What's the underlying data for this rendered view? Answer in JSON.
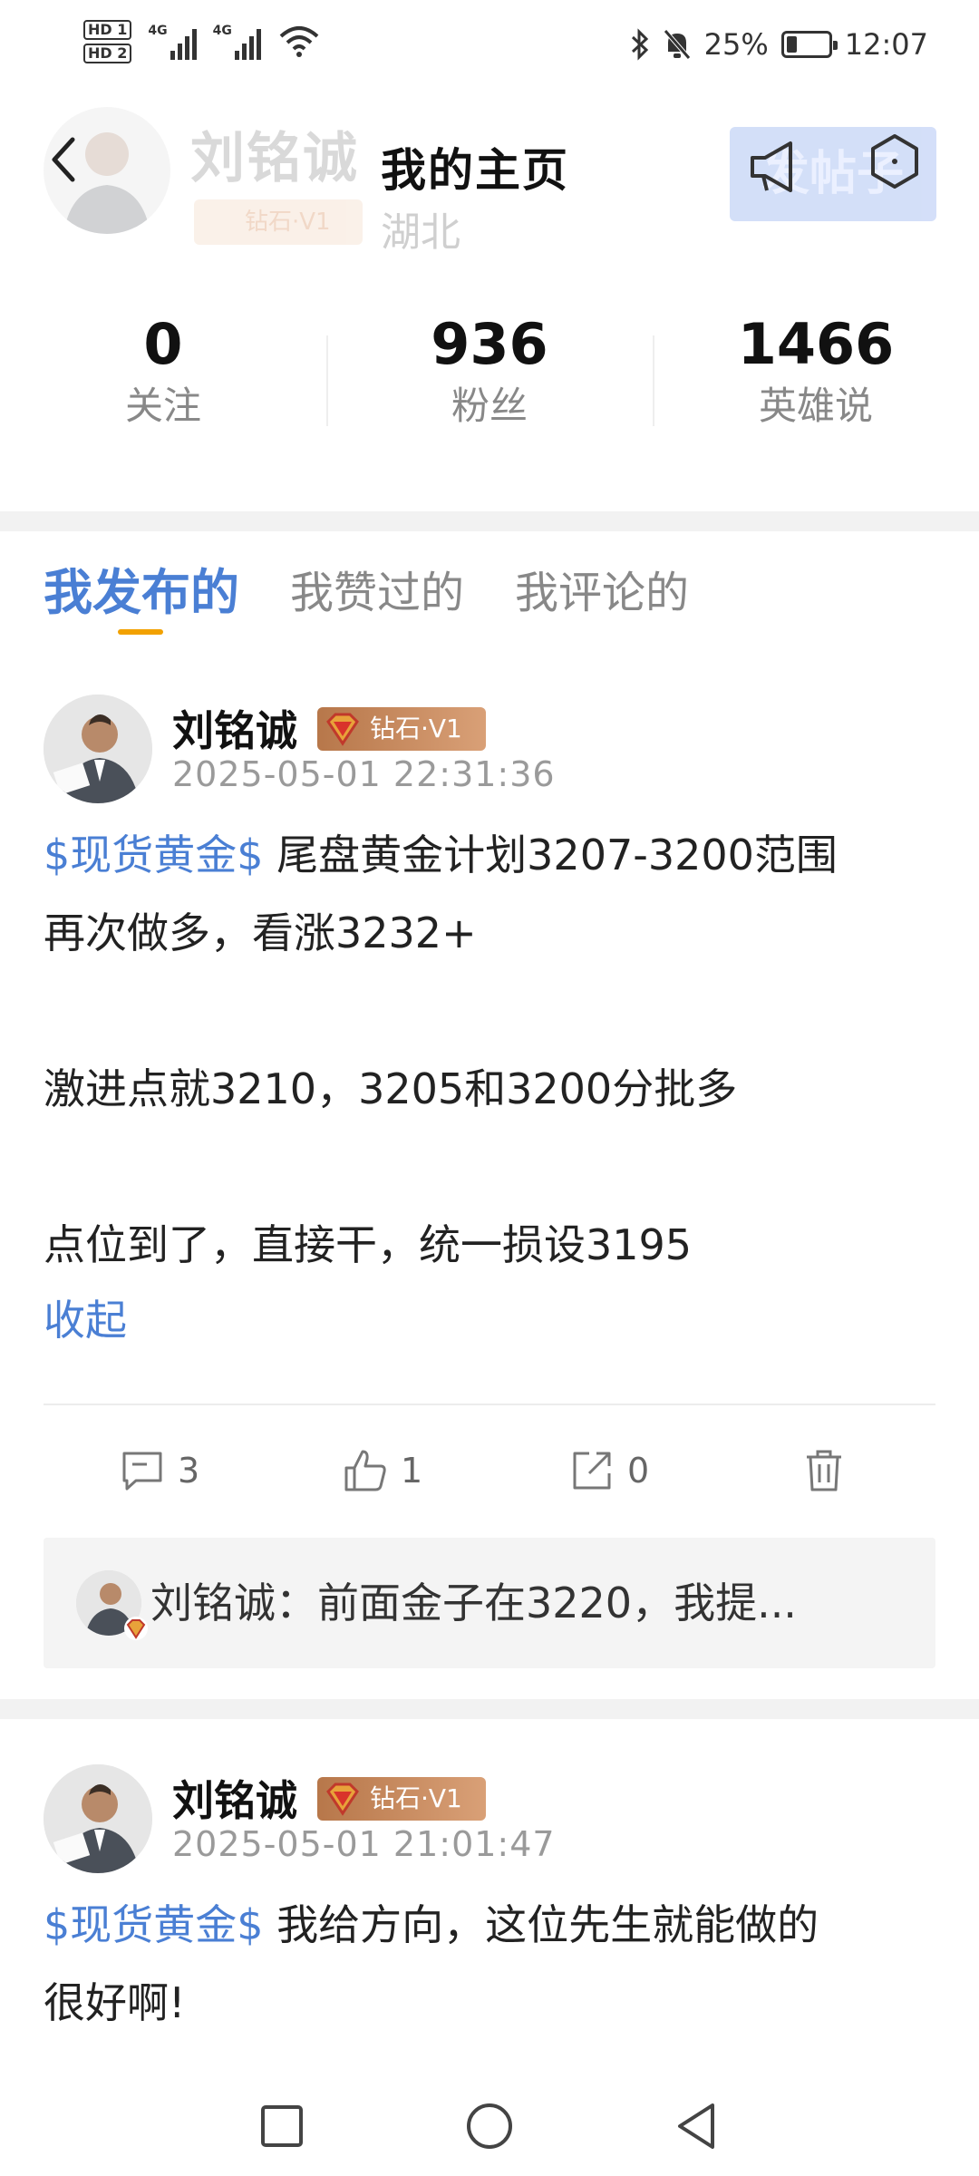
{
  "status_bar": {
    "hd1": "HD 1",
    "hd2": "HD 2",
    "net1": "4G",
    "net2": "4G",
    "battery_text": "25%",
    "battery_level": 0.25,
    "time": "12:07"
  },
  "header": {
    "faded_name": "刘铭诚",
    "faded_badge": "钻石·V1",
    "faded_region": "湖北",
    "title": "我的主页",
    "post_button_label": "发帖子"
  },
  "stats": [
    {
      "value": "0",
      "label": "关注"
    },
    {
      "value": "936",
      "label": "粉丝"
    },
    {
      "value": "1466",
      "label": "英雄说"
    }
  ],
  "tabs": [
    {
      "label": "我发布的",
      "active": true
    },
    {
      "label": "我赞过的",
      "active": false
    },
    {
      "label": "我评论的",
      "active": false
    }
  ],
  "posts": [
    {
      "author": "刘铭诚",
      "badge": "钻石·V1",
      "time": "2025-05-01 22:31:36",
      "tag": "$现货黄金$",
      "line1_rest": " 尾盘黄金计划3207-3200范围",
      "line2": "再次做多，看涨3232+",
      "line3": "激进点就3210，3205和3200分批多",
      "line4": "点位到了，直接干，统一损设3195",
      "collapse": "收起",
      "comments": "3",
      "likes": "1",
      "shares": "0",
      "top_comment": "刘铭诚：前面金子在3220，我提..."
    },
    {
      "author": "刘铭诚",
      "badge": "钻石·V1",
      "time": "2025-05-01 21:01:47",
      "tag": "$现货黄金$",
      "line1_rest": " 我给方向，这位先生就能做的",
      "line2": "很好啊!"
    }
  ],
  "colors": {
    "accent_blue": "#4a7fd4",
    "tab_underline": "#f2a100",
    "badge_brown": "#c08354",
    "gap_gray": "#f2f2f2"
  }
}
